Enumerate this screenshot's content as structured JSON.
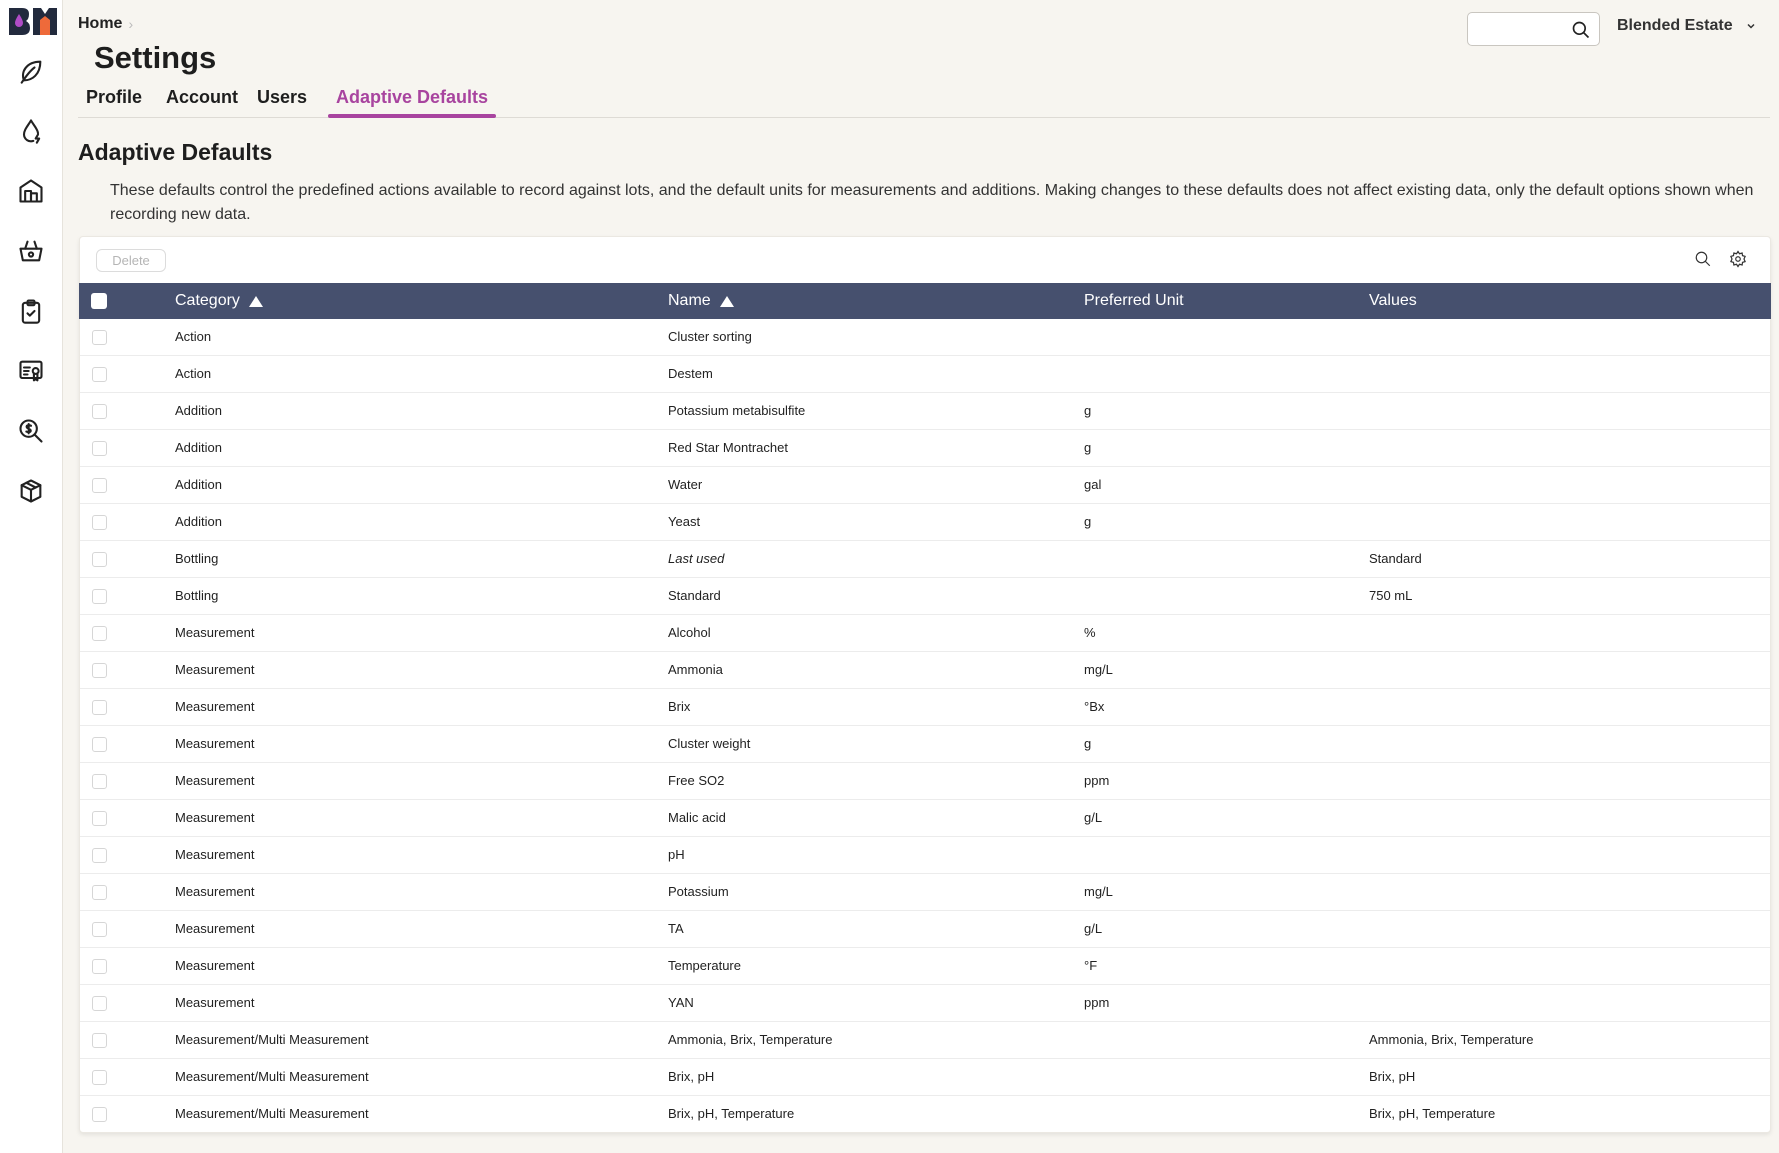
{
  "breadcrumb": {
    "home": "Home",
    "separator": "›"
  },
  "page": {
    "title": "Settings"
  },
  "header": {
    "search": {
      "value": "",
      "placeholder": ""
    },
    "organization": "Blended Estate"
  },
  "tabs": [
    {
      "label": "Profile",
      "active": false
    },
    {
      "label": "Account",
      "active": false
    },
    {
      "label": "Users",
      "active": false
    },
    {
      "label": "Adaptive Defaults",
      "active": true
    }
  ],
  "section": {
    "title": "Adaptive Defaults",
    "description": "These defaults control the predefined actions available to record against lots, and the default units for measurements and additions. Making changes to these defaults does not affect existing data, only the default options shown when recording new data."
  },
  "sidebar": {
    "items": [
      {
        "icon": "leaf-icon"
      },
      {
        "icon": "drop-icon"
      },
      {
        "icon": "winery-icon"
      },
      {
        "icon": "basket-icon"
      },
      {
        "icon": "clipboard-check-icon"
      },
      {
        "icon": "certificate-icon"
      },
      {
        "icon": "cost-search-icon"
      },
      {
        "icon": "box-icon"
      }
    ]
  },
  "toolbar": {
    "delete_label": "Delete"
  },
  "table": {
    "columns": [
      {
        "label": "Category",
        "sort": "asc"
      },
      {
        "label": "Name",
        "sort": "asc"
      },
      {
        "label": "Preferred Unit",
        "sort": null
      },
      {
        "label": "Values",
        "sort": null
      }
    ],
    "rows": [
      {
        "category": "Action",
        "name": "Cluster sorting",
        "unit": "",
        "values": ""
      },
      {
        "category": "Action",
        "name": "Destem",
        "unit": "",
        "values": ""
      },
      {
        "category": "Addition",
        "name": "Potassium metabisulfite",
        "unit": "g",
        "values": ""
      },
      {
        "category": "Addition",
        "name": "Red Star Montrachet",
        "unit": "g",
        "values": ""
      },
      {
        "category": "Addition",
        "name": "Water",
        "unit": "gal",
        "values": ""
      },
      {
        "category": "Addition",
        "name": "Yeast",
        "unit": "g",
        "values": ""
      },
      {
        "category": "Bottling",
        "name": "Last used",
        "name_italic": true,
        "unit": "",
        "values": "Standard"
      },
      {
        "category": "Bottling",
        "name": "Standard",
        "unit": "",
        "values": "750 mL"
      },
      {
        "category": "Measurement",
        "name": "Alcohol",
        "unit": "%",
        "values": ""
      },
      {
        "category": "Measurement",
        "name": "Ammonia",
        "unit": "mg/L",
        "values": ""
      },
      {
        "category": "Measurement",
        "name": "Brix",
        "unit": "°Bx",
        "values": ""
      },
      {
        "category": "Measurement",
        "name": "Cluster weight",
        "unit": "g",
        "values": ""
      },
      {
        "category": "Measurement",
        "name": "Free SO2",
        "unit": "ppm",
        "values": ""
      },
      {
        "category": "Measurement",
        "name": "Malic acid",
        "unit": "g/L",
        "values": ""
      },
      {
        "category": "Measurement",
        "name": "pH",
        "unit": "",
        "values": ""
      },
      {
        "category": "Measurement",
        "name": "Potassium",
        "unit": "mg/L",
        "values": ""
      },
      {
        "category": "Measurement",
        "name": "TA",
        "unit": "g/L",
        "values": ""
      },
      {
        "category": "Measurement",
        "name": "Temperature",
        "unit": "°F",
        "values": ""
      },
      {
        "category": "Measurement",
        "name": "YAN",
        "unit": "ppm",
        "values": ""
      },
      {
        "category": "Measurement/Multi Measurement",
        "name": "Ammonia, Brix, Temperature",
        "unit": "",
        "values": "Ammonia, Brix, Temperature"
      },
      {
        "category": "Measurement/Multi Measurement",
        "name": "Brix, pH",
        "unit": "",
        "values": "Brix, pH"
      },
      {
        "category": "Measurement/Multi Measurement",
        "name": "Brix, pH, Temperature",
        "unit": "",
        "values": "Brix, pH, Temperature"
      }
    ]
  },
  "colors": {
    "accent": "#a8449f",
    "table_header": "#46506e",
    "background": "#f7f5f0",
    "logo_dark": "#222a3d",
    "logo_purple": "#b04cc6",
    "logo_orange": "#ee6a3a"
  }
}
